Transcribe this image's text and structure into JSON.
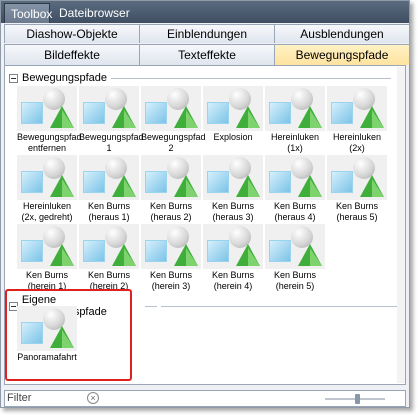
{
  "top_tabs": [
    "Toolbox",
    "Dateibrowser"
  ],
  "row1_tabs": [
    "Diashow-Objekte",
    "Einblendungen",
    "Ausblendungen"
  ],
  "row2_tabs": [
    "Bildeffekte",
    "Texteffekte",
    "Bewegungspfade"
  ],
  "group1": {
    "title": "Bewegungspfade",
    "items": [
      {
        "l1": "Bewegungspfad",
        "l2": "entfernen"
      },
      {
        "l1": "Bewegungspfad",
        "l2": "1"
      },
      {
        "l1": "Bewegungspfad",
        "l2": "2"
      },
      {
        "l1": "Explosion",
        "l2": ""
      },
      {
        "l1": "Hereinluken",
        "l2": "(1x)"
      },
      {
        "l1": "Hereinluken",
        "l2": "(2x)"
      },
      {
        "l1": "Hereinluken",
        "l2": "(2x, gedreht)"
      },
      {
        "l1": "Ken Burns",
        "l2": "(heraus 1)"
      },
      {
        "l1": "Ken Burns",
        "l2": "(heraus 2)"
      },
      {
        "l1": "Ken Burns",
        "l2": "(heraus 3)"
      },
      {
        "l1": "Ken Burns",
        "l2": "(heraus 4)"
      },
      {
        "l1": "Ken Burns",
        "l2": "(heraus 5)"
      },
      {
        "l1": "Ken Burns",
        "l2": "(herein 1)"
      },
      {
        "l1": "Ken Burns",
        "l2": "(herein 2)"
      },
      {
        "l1": "Ken Burns",
        "l2": "(herein 3)"
      },
      {
        "l1": "Ken Burns",
        "l2": "(herein 4)"
      },
      {
        "l1": "Ken Burns",
        "l2": "(herein 5)"
      }
    ]
  },
  "group2": {
    "title": "Eigene Bewegungspfade",
    "items": [
      {
        "l1": "Panoramafahrt",
        "l2": ""
      }
    ]
  },
  "filter": {
    "placeholder": "Filter"
  },
  "colors": {
    "selected_tab": "#ffe3a0",
    "highlight_border": "#e0201f"
  }
}
